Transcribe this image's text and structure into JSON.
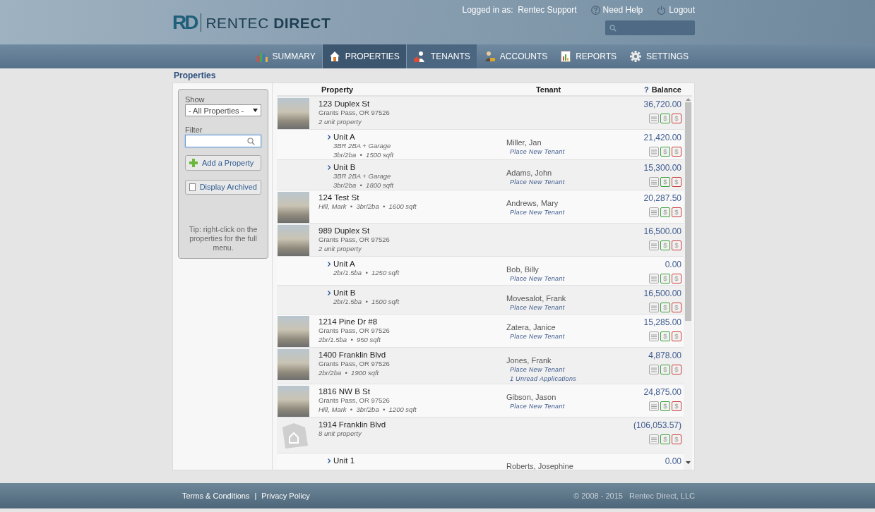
{
  "header": {
    "logo_mark": "RD",
    "logo_text": "RENTEC **DIRECT**",
    "logged_in_label": "Logged in as:",
    "user": "Rentec Support",
    "help": "Need Help",
    "logout": "Logout"
  },
  "nav": [
    {
      "label": "SUMMARY",
      "selected": false,
      "highlighted": false
    },
    {
      "label": "PROPERTIES",
      "selected": true,
      "highlighted": false
    },
    {
      "label": "TENANTS",
      "selected": false,
      "highlighted": true
    },
    {
      "label": "ACCOUNTS",
      "selected": false,
      "highlighted": false
    },
    {
      "label": "REPORTS",
      "selected": false,
      "highlighted": false
    },
    {
      "label": "SETTINGS",
      "selected": false,
      "highlighted": false
    }
  ],
  "page_title": "Properties",
  "sidebar": {
    "show_label": "Show",
    "show_value": "- All Properties -",
    "filter_label": "Filter",
    "filter": {
      "focused": true
    },
    "add_button": "Add a Property",
    "archived": {
      "label": "Display Archived",
      "checked": false
    },
    "tip": "Tip: right-click on the properties for the full menu."
  },
  "table": {
    "columns": [
      "Property",
      "Tenant",
      "Balance"
    ],
    "balance_help": "?",
    "rows": [
      {
        "kind": "property",
        "photo": true,
        "name": "123 Duplex St",
        "lines": [
          {
            "kind": "address",
            "text": "Grants Pass, OR 97526"
          },
          {
            "kind": "detail",
            "text": "2 unit property"
          }
        ],
        "balance": "36,720.00",
        "actions": [
          {
            "kind": "notes"
          },
          {
            "kind": "charge",
            "symbol": "$"
          },
          {
            "kind": "payment",
            "symbol": "$"
          }
        ]
      },
      {
        "kind": "unit",
        "name": "Unit A",
        "lines": [
          {
            "kind": "detail",
            "text": "3BR 2BA + Garage"
          },
          {
            "kind": "detail",
            "text": "3br/2ba  •  1500 sqft"
          }
        ],
        "tenant": "Miller, Jan",
        "tenant_links": [
          "Place New Tenant"
        ],
        "balance": "21,420.00",
        "actions": [
          {
            "kind": "notes"
          },
          {
            "kind": "charge",
            "symbol": "$"
          },
          {
            "kind": "payment",
            "symbol": "$"
          }
        ]
      },
      {
        "kind": "unit",
        "name": "Unit B",
        "lines": [
          {
            "kind": "detail",
            "text": "3BR 2BA + Garage"
          },
          {
            "kind": "detail",
            "text": "3br/2ba  •  1800 sqft"
          }
        ],
        "tenant": "Adams, John",
        "tenant_links": [
          "Place New Tenant"
        ],
        "balance": "15,300.00",
        "actions": [
          {
            "kind": "notes"
          },
          {
            "kind": "charge",
            "symbol": "$"
          },
          {
            "kind": "payment",
            "symbol": "$"
          }
        ]
      },
      {
        "kind": "property",
        "photo": true,
        "name": "124 Test St",
        "lines": [
          {
            "kind": "detail",
            "text": "Hill, Mark  •  3br/2ba  •  1600 sqft"
          }
        ],
        "tenant": "Andrews, Mary",
        "tenant_links": [
          "Place New Tenant"
        ],
        "balance": "20,287.50",
        "actions": [
          {
            "kind": "notes"
          },
          {
            "kind": "charge",
            "symbol": "$"
          },
          {
            "kind": "payment",
            "symbol": "$"
          }
        ]
      },
      {
        "kind": "property",
        "photo": true,
        "name": "989 Duplex St",
        "lines": [
          {
            "kind": "address",
            "text": "Grants Pass, OR 97526"
          },
          {
            "kind": "detail",
            "text": "2 unit property"
          }
        ],
        "balance": "16,500.00",
        "actions": [
          {
            "kind": "notes"
          },
          {
            "kind": "charge",
            "symbol": "$"
          },
          {
            "kind": "payment",
            "symbol": "$"
          }
        ]
      },
      {
        "kind": "unit",
        "name": "Unit A",
        "lines": [
          {
            "kind": "detail",
            "text": "2br/1.5ba  •  1250 sqft"
          }
        ],
        "tenant": "Bob, Billy",
        "tenant_links": [
          "Place New Tenant"
        ],
        "balance": "0.00",
        "actions": [
          {
            "kind": "notes"
          },
          {
            "kind": "charge",
            "symbol": "$"
          },
          {
            "kind": "payment",
            "symbol": "$"
          }
        ]
      },
      {
        "kind": "unit",
        "name": "Unit B",
        "lines": [
          {
            "kind": "detail",
            "text": "2br/1.5ba  •  1500 sqft"
          }
        ],
        "tenant": "Movesalot, Frank",
        "tenant_links": [
          "Place New Tenant"
        ],
        "balance": "16,500.00",
        "actions": [
          {
            "kind": "notes"
          },
          {
            "kind": "charge",
            "symbol": "$"
          },
          {
            "kind": "payment",
            "symbol": "$"
          }
        ]
      },
      {
        "kind": "property",
        "photo": true,
        "name": "1214 Pine Dr #8",
        "lines": [
          {
            "kind": "address",
            "text": "Grants Pass, OR 97526"
          },
          {
            "kind": "detail",
            "text": "2br/1.5ba  •  950 sqft"
          }
        ],
        "tenant": "Zatera, Janice",
        "tenant_links": [
          "Place New Tenant"
        ],
        "balance": "15,285.00",
        "actions": [
          {
            "kind": "notes"
          },
          {
            "kind": "charge",
            "symbol": "$"
          },
          {
            "kind": "payment",
            "symbol": "$"
          }
        ]
      },
      {
        "kind": "property",
        "photo": true,
        "name": "1400 Franklin Blvd",
        "lines": [
          {
            "kind": "address",
            "text": "Grants Pass, OR 97526"
          },
          {
            "kind": "detail",
            "text": "2br/2ba  •  1900 sqft"
          }
        ],
        "tenant": "Jones, Frank",
        "tenant_links": [
          "Place New Tenant",
          "1 Unread Applications"
        ],
        "balance": "4,878.00",
        "actions": [
          {
            "kind": "notes"
          },
          {
            "kind": "charge",
            "symbol": "$"
          },
          {
            "kind": "payment",
            "symbol": "$"
          }
        ]
      },
      {
        "kind": "property",
        "photo": true,
        "name": "1816 NW B St",
        "lines": [
          {
            "kind": "address",
            "text": "Grants Pass, OR 97526"
          },
          {
            "kind": "detail",
            "text": "Hill, Mark  •  3br/2ba  •  1200 sqft"
          }
        ],
        "tenant": "Gibson, Jason",
        "tenant_links": [
          "Place New Tenant"
        ],
        "balance": "24,875.00",
        "actions": [
          {
            "kind": "notes"
          },
          {
            "kind": "charge",
            "symbol": "$"
          },
          {
            "kind": "payment",
            "symbol": "$"
          }
        ]
      },
      {
        "kind": "property",
        "photo": false,
        "name": "1914 Franklin Blvd",
        "lines": [
          {
            "kind": "detail",
            "text": "8 unit property"
          }
        ],
        "balance": "(106,053.57)",
        "actions": [
          {
            "kind": "notes"
          },
          {
            "kind": "charge",
            "symbol": "$"
          },
          {
            "kind": "payment",
            "symbol": "$"
          }
        ]
      },
      {
        "kind": "unit",
        "name": "Unit 1",
        "tenant": "Roberts, Josephine",
        "balance": "0.00"
      }
    ]
  },
  "footer": {
    "links": [
      "Terms & Conditions",
      "Privacy Policy"
    ],
    "separator": "|",
    "copyright": "© 2008 - 2015   Rentec Direct, LLC"
  }
}
